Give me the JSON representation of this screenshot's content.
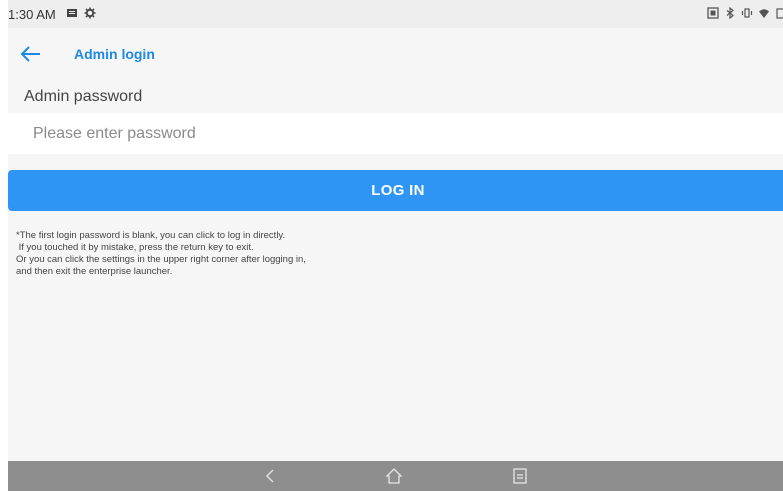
{
  "status_bar": {
    "time": "1:30 AM",
    "left_icons": [
      "notification-icon",
      "settings-gear-icon"
    ],
    "right_icons": [
      "screenshot-icon",
      "bluetooth-icon",
      "vibrate-icon",
      "wifi-icon",
      "battery-icon"
    ]
  },
  "header": {
    "title": "Admin login",
    "back_icon": "arrow-left-icon",
    "accent_color": "#1e88e5"
  },
  "form": {
    "label": "Admin password",
    "password_value": "",
    "password_placeholder": "Please enter password",
    "login_label": "LOG IN",
    "button_color": "#2f95f5"
  },
  "notes": [
    "*The first login password is blank, you can click to log in directly.",
    " If you touched it by mistake, press the return key to exit.",
    "Or you can click the settings in the upper right corner after logging in,",
    "and then exit the enterprise launcher."
  ],
  "nav_bar": {
    "buttons": [
      "back-icon",
      "home-icon",
      "recents-icon"
    ]
  }
}
